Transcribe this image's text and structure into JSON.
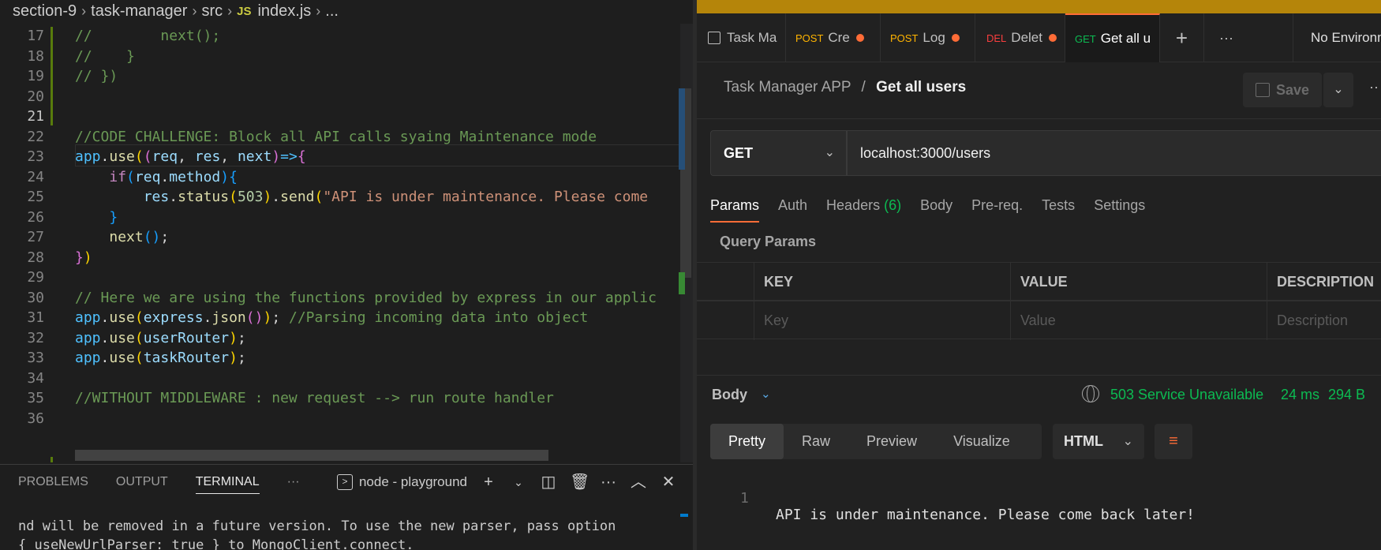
{
  "vscode": {
    "breadcrumb": [
      "section-9",
      "task-manager",
      "src",
      "index.js",
      "..."
    ],
    "js_badge": "JS",
    "lines": [
      {
        "n": "17",
        "parts": [
          [
            "cm",
            "//        next();"
          ]
        ]
      },
      {
        "n": "18",
        "parts": [
          [
            "cm",
            "//    }"
          ]
        ]
      },
      {
        "n": "19",
        "parts": [
          [
            "cm",
            "// })"
          ]
        ]
      },
      {
        "n": "20",
        "parts": []
      },
      {
        "n": "21",
        "parts": [],
        "active": true
      },
      {
        "n": "22",
        "parts": [
          [
            "cm",
            "//CODE CHALLENGE: Block all API calls syaing Maintenance mode"
          ]
        ]
      },
      {
        "n": "23",
        "parts": [
          [
            "var",
            "app"
          ],
          [
            "txt",
            "."
          ],
          [
            "fn",
            "use"
          ],
          [
            "br1",
            "("
          ],
          [
            "br2",
            "("
          ],
          [
            "par",
            "req"
          ],
          [
            "txt",
            ", "
          ],
          [
            "par",
            "res"
          ],
          [
            "txt",
            ", "
          ],
          [
            "par",
            "next"
          ],
          [
            "br2",
            ")"
          ],
          [
            "var",
            "=>"
          ],
          [
            "br2",
            "{"
          ]
        ]
      },
      {
        "n": "24",
        "parts": [
          [
            "txt",
            "    "
          ],
          [
            "kw",
            "if"
          ],
          [
            "br3",
            "("
          ],
          [
            "par",
            "req"
          ],
          [
            "txt",
            "."
          ],
          [
            "par",
            "method"
          ],
          [
            "br3",
            ")"
          ],
          [
            "br3",
            "{"
          ]
        ]
      },
      {
        "n": "25",
        "parts": [
          [
            "txt",
            "        "
          ],
          [
            "par",
            "res"
          ],
          [
            "txt",
            "."
          ],
          [
            "fn",
            "status"
          ],
          [
            "br1",
            "("
          ],
          [
            "num",
            "503"
          ],
          [
            "br1",
            ")"
          ],
          [
            "txt",
            "."
          ],
          [
            "fn",
            "send"
          ],
          [
            "br1",
            "("
          ],
          [
            "str",
            "\"API is under maintenance. Please come"
          ]
        ]
      },
      {
        "n": "26",
        "parts": [
          [
            "txt",
            "    "
          ],
          [
            "br3",
            "}"
          ]
        ]
      },
      {
        "n": "27",
        "parts": [
          [
            "txt",
            "    "
          ],
          [
            "fn",
            "next"
          ],
          [
            "br3",
            "()"
          ],
          [
            "txt",
            ";"
          ]
        ]
      },
      {
        "n": "28",
        "parts": [
          [
            "br2",
            "}"
          ],
          [
            "br1",
            ")"
          ]
        ]
      },
      {
        "n": "29",
        "parts": []
      },
      {
        "n": "30",
        "parts": [
          [
            "cm",
            "// Here we are using the functions provided by express in our applic"
          ]
        ]
      },
      {
        "n": "31",
        "parts": [
          [
            "var",
            "app"
          ],
          [
            "txt",
            "."
          ],
          [
            "fn",
            "use"
          ],
          [
            "br1",
            "("
          ],
          [
            "par",
            "express"
          ],
          [
            "txt",
            "."
          ],
          [
            "fn",
            "json"
          ],
          [
            "br2",
            "()"
          ],
          [
            "br1",
            ")"
          ],
          [
            "txt",
            "; "
          ],
          [
            "cm",
            "//Parsing incoming data into object"
          ]
        ]
      },
      {
        "n": "32",
        "parts": [
          [
            "var",
            "app"
          ],
          [
            "txt",
            "."
          ],
          [
            "fn",
            "use"
          ],
          [
            "br1",
            "("
          ],
          [
            "par",
            "userRouter"
          ],
          [
            "br1",
            ")"
          ],
          [
            "txt",
            ";"
          ]
        ]
      },
      {
        "n": "33",
        "parts": [
          [
            "var",
            "app"
          ],
          [
            "txt",
            "."
          ],
          [
            "fn",
            "use"
          ],
          [
            "br1",
            "("
          ],
          [
            "par",
            "taskRouter"
          ],
          [
            "br1",
            ")"
          ],
          [
            "txt",
            ";"
          ]
        ]
      },
      {
        "n": "34",
        "parts": []
      },
      {
        "n": "35",
        "parts": [
          [
            "cm",
            "//WITHOUT MIDDLEWARE : new request --> run route handler"
          ]
        ]
      },
      {
        "n": "36",
        "parts": []
      }
    ],
    "panel": {
      "tabs": [
        "PROBLEMS",
        "OUTPUT",
        "TERMINAL",
        "···"
      ],
      "active_tab": "TERMINAL",
      "terminal_name": "node - playground",
      "terminal_lines": [
        "nd will be removed in a future version. To use the new parser, pass option",
        "{ useNewUrlParser: true } to MongoClient.connect."
      ]
    }
  },
  "postman": {
    "tabs": [
      {
        "method": "",
        "label": "Task Ma",
        "dot": false
      },
      {
        "method": "POST",
        "label": "Cre",
        "dot": true
      },
      {
        "method": "POST",
        "label": "Log",
        "dot": true
      },
      {
        "method": "DEL",
        "label": "Delet",
        "dot": true
      },
      {
        "method": "GET",
        "label": "Get all u",
        "dot": false,
        "active": true
      }
    ],
    "environment": "No Environmen",
    "crumb_parent": "Task Manager APP",
    "crumb_sep": "/",
    "crumb_current": "Get all users",
    "save_label": "Save",
    "method": "GET",
    "url": "localhost:3000/users",
    "request_tabs": [
      "Params",
      "Auth",
      "Headers",
      "Body",
      "Pre-req.",
      "Tests",
      "Settings"
    ],
    "headers_count": "(6)",
    "query_params_title": "Query Params",
    "table_headers": [
      "KEY",
      "VALUE",
      "DESCRIPTION"
    ],
    "table_placeholders": [
      "Key",
      "Value",
      "Description"
    ],
    "response": {
      "body_label": "Body",
      "status": "503 Service Unavailable",
      "time": "24 ms",
      "size": "294 B",
      "view_tabs": [
        "Pretty",
        "Raw",
        "Preview",
        "Visualize"
      ],
      "format": "HTML",
      "line_number": "1",
      "body_text": "API is under maintenance. Please come back later!"
    }
  }
}
